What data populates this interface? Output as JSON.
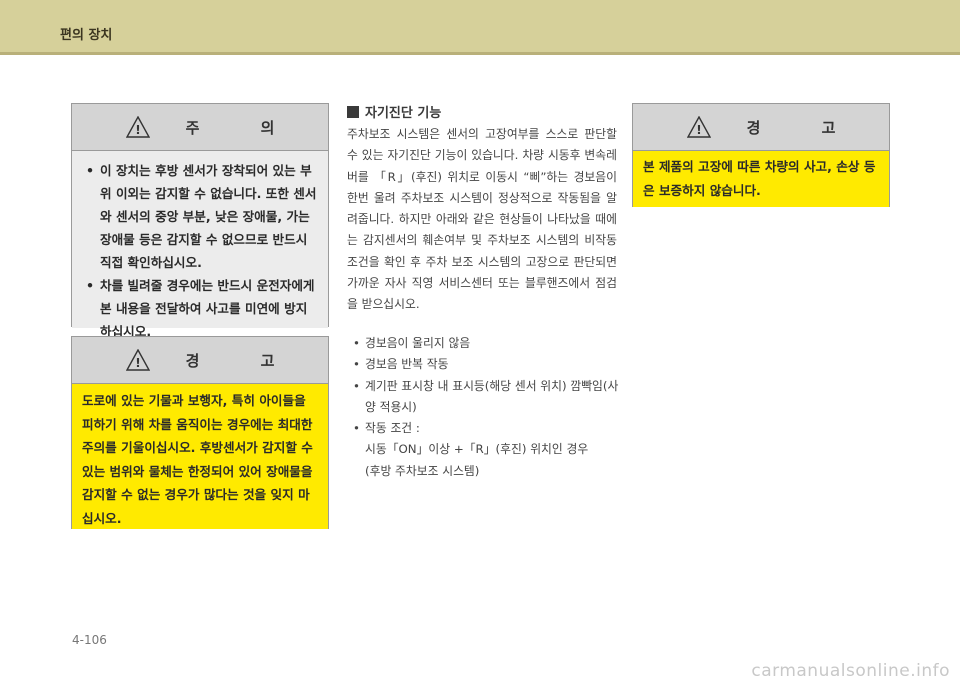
{
  "header": {
    "title": "편의 장치"
  },
  "caution": {
    "title": "주 의",
    "items": [
      "이 장치는 후방 센서가 장착되어 있는 부위 이외는 감지할 수 없습니다. 또한 센서와 센서의 중앙 부분, 낮은 장애물, 가는 장애물 등은 감지할 수 없으므로 반드시 직접 확인하십시오.",
      "차를 빌려줄 경우에는 반드시 운전자에게 본 내용을 전달하여 사고를 미연에 방지하십시오."
    ]
  },
  "warning_left": {
    "title": "경 고",
    "text": "도로에 있는 기물과 보행자, 특히 아이들을 피하기 위해 차를 움직이는 경우에는 최대한 주의를 기울이십시오. 후방센서가 감지할 수 있는 범위와 물체는 한정되어 있어 장애물을 감지할 수 없는 경우가 많다는 것을 잊지 마십시오."
  },
  "section": {
    "heading": "자기진단 기능",
    "paragraph": "주차보조 시스템은 센서의 고장여부를 스스로 판단할 수 있는 자기진단 기능이 있습니다. 차량 시동후 변속레버를 「R」(후진) 위치로 이동시 “삐”하는 경보음이 한번 울려 주차보조 시스템이 정상적으로 작동됨을 알려줍니다. 하지만 아래와 같은 현상들이 나타났을 때에는 감지센서의 훼손여부 및 주차보조 시스템의 비작동 조건을 확인 후 주차 보조 시스템의 고장으로 판단되면 가까운 자사 직영 서비스센터 또는 블루핸즈에서 점검을 받으십시오.",
    "list": [
      "경보음이 울리지 않음",
      "경보음 반복 작동",
      "계기판 표시창 내 표시등(해당 센서 위치) 깜빡임(사양 적용시)",
      "작동 조건 :"
    ],
    "condition_lines": [
      "시동「ON」이상 +「R」(후진) 위치인 경우",
      "(후방 주차보조 시스템)"
    ]
  },
  "warning_right": {
    "title": "경 고",
    "text": "본 제품의 고장에 따른 차량의 사고, 손상 등은 보증하지 않습니다."
  },
  "page_number": "4-106",
  "watermark": "carmanualsonline.info",
  "colors": {
    "header": "#d6d09a",
    "warning_bg": "#ffea00",
    "caution_bg": "#ececec",
    "box_head": "#d4d4d4"
  },
  "icons": [
    "warning-triangle-icon"
  ]
}
